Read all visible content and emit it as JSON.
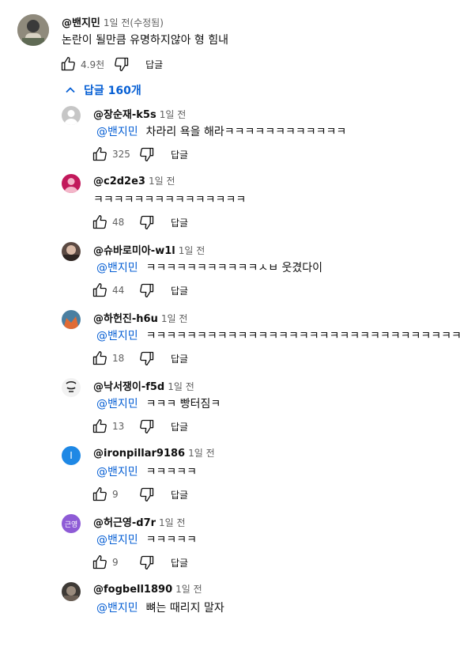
{
  "top_comment": {
    "author": "@밴지민",
    "time": "1일 전(수정됨)",
    "text": "논란이 될만큼 유명하지않아 형 힘내",
    "likes": "4.9천",
    "reply_label": "답글"
  },
  "replies_toggle": {
    "label": "답글 160개",
    "icon": "chevron-up-icon"
  },
  "replies": [
    {
      "author": "@장순재-k5s",
      "time": "1일 전",
      "mention": "@밴지민",
      "text": "차라리 욕을 해라ㅋㅋㅋㅋㅋㅋㅋㅋㅋㅋㅋㅋ",
      "likes": "325",
      "reply_label": "답글",
      "avatar": "default-gray"
    },
    {
      "author": "@c2d2e3",
      "time": "1일 전",
      "mention": "",
      "text": "ㅋㅋㅋㅋㅋㅋㅋㅋㅋㅋㅋㅋㅋㅋㅋ",
      "likes": "48",
      "reply_label": "답글",
      "avatar": "default-pink"
    },
    {
      "author": "@슈바로미아-w1l",
      "time": "1일 전",
      "mention": "@밴지민",
      "text": "ㅋㅋㅋㅋㅋㅋㅋㅋㅋㅋㅋㅅㅂ 웃겼다이",
      "likes": "44",
      "reply_label": "답글",
      "avatar": "photo"
    },
    {
      "author": "@하헌진-h6u",
      "time": "1일 전",
      "mention": "@밴지민",
      "text": "ㅋㅋㅋㅋㅋㅋㅋㅋㅋㅋㅋㅋㅋㅋㅋㅋㅋㅋㅋㅋㅋㅋㅋㅋㅋㅋㅋㅋㅋㅋㅋ",
      "likes": "18",
      "reply_label": "답글",
      "avatar": "photo-orange"
    },
    {
      "author": "@낙서쟁이-f5d",
      "time": "1일 전",
      "mention": "@밴지민",
      "text": "ㅋㅋㅋ 빵터짐ㅋ",
      "likes": "13",
      "reply_label": "답글",
      "avatar": "drawing"
    },
    {
      "author": "@ironpillar9186",
      "time": "1일 전",
      "mention": "@밴지민",
      "text": "ㅋㅋㅋㅋㅋ",
      "likes": "9",
      "reply_label": "답글",
      "avatar": "letter",
      "avatar_letter": "I"
    },
    {
      "author": "@허근영-d7r",
      "time": "1일 전",
      "mention": "@밴지민",
      "text": "ㅋㅋㅋㅋㅋ",
      "likes": "9",
      "reply_label": "답글",
      "avatar": "letter",
      "avatar_letter": "근영"
    },
    {
      "author": "@fogbell1890",
      "time": "1일 전",
      "mention": "@밴지민",
      "text": "뼈는 때리지 말자",
      "likes": "",
      "reply_label": "",
      "avatar": "photo-dark"
    }
  ],
  "colors": {
    "mention": "#065fd4",
    "secondary_text": "#606060",
    "avatar_gray": "#c6c6c6",
    "avatar_pink": "#c2185b",
    "avatar_blue": "#1e88e5",
    "avatar_purple": "#8e5bd6"
  }
}
